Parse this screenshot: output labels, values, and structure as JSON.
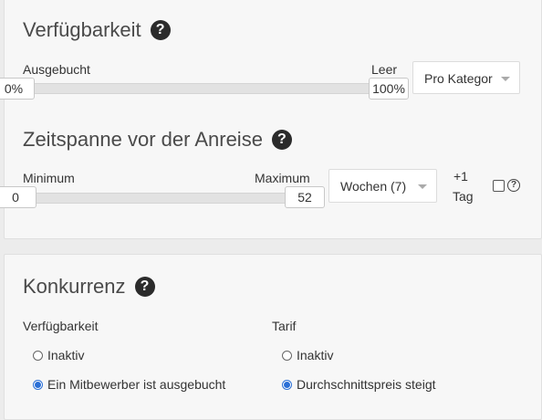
{
  "availability": {
    "title": "Verfügbarkeit",
    "left_label": "Ausgebucht",
    "right_label": "Leer",
    "min_value": "0%",
    "max_value": "100%",
    "select_value": "Pro Kategor"
  },
  "lead_time": {
    "title": "Zeitspanne vor der Anreise",
    "left_label": "Minimum",
    "right_label": "Maximum",
    "min_value": "0",
    "max_value": "52",
    "select_value": "Wochen (7)",
    "plus_one_line1": "+1",
    "plus_one_line2": "Tag"
  },
  "competition": {
    "title": "Konkurrenz",
    "availability_label": "Verfügbarkeit",
    "availability_options": [
      "Inaktiv",
      "Ein Mitbewerber ist ausgebucht"
    ],
    "tariff_label": "Tarif",
    "tariff_options": [
      "Inaktiv",
      "Durchschnittspreis steigt"
    ]
  },
  "icons": {
    "help": "?",
    "small_help": "?"
  },
  "colors": {
    "radio_selected": "#2a6fd6",
    "panel_bg": "#f7f7f7",
    "page_bg": "#ececec"
  }
}
